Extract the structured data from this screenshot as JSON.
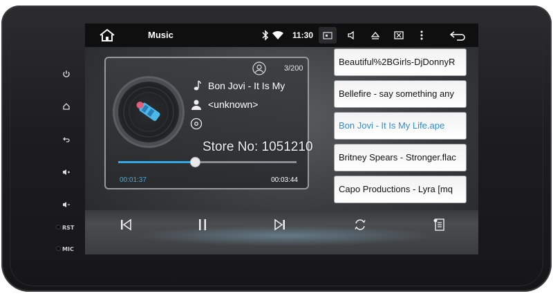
{
  "statusbar": {
    "title": "Music",
    "time": "11:30",
    "icons": [
      "home-icon",
      "bluetooth-icon",
      "wifi-icon",
      "screenshot-icon",
      "volume-icon",
      "eject-icon",
      "close-window-icon",
      "more-vert-icon",
      "back-icon"
    ]
  },
  "side_panel": {
    "buttons": [
      "power-icon",
      "home-icon",
      "back-icon",
      "volume-up-icon",
      "volume-down-icon"
    ],
    "rst_label": "RST",
    "mic_label": "MIC"
  },
  "now_playing": {
    "track_count": "3/200",
    "title": "Bon Jovi - It Is My",
    "artist": "<unknown>",
    "elapsed": "00:01:37",
    "total": "00:03:44",
    "progress_fraction": 0.43
  },
  "playlist": {
    "items": [
      {
        "label": "Beautiful%2BGirls-DjDonnyR",
        "active": false
      },
      {
        "label": "Bellefire - say something any",
        "active": false
      },
      {
        "label": "Bon Jovi - It Is My Life.ape",
        "active": true
      },
      {
        "label": "Britney Spears - Stronger.flac",
        "active": false
      },
      {
        "label": "Capo Productions - Lyra [mq",
        "active": false
      }
    ]
  },
  "controls": [
    "previous-icon",
    "pause-icon",
    "next-icon",
    "repeat-icon",
    "playlist-icon"
  ],
  "watermark": "Store No: 1051210",
  "colors": {
    "accent": "#2fa8e6",
    "active_item": "#2f8bd8",
    "statusbar": "#0f0f10"
  }
}
